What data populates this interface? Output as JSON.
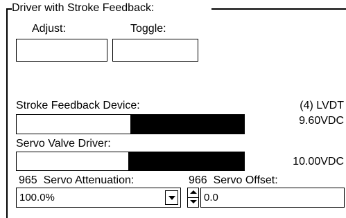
{
  "group": {
    "title": "Driver with Stroke Feedback:"
  },
  "adjust": {
    "label": "Adjust:",
    "value": ""
  },
  "toggle": {
    "label": "Toggle:",
    "value": ""
  },
  "stroke_feedback": {
    "label": "Stroke Feedback Device:",
    "device": "(4) LVDT",
    "reading": "9.60VDC",
    "white_fraction": 0.5,
    "black_fraction": 0.5
  },
  "servo_driver": {
    "label": "Servo Valve Driver:",
    "reading": "10.00VDC",
    "white_fraction": 0.49,
    "black_fraction": 0.51
  },
  "servo_attenuation": {
    "number": "965",
    "label": "Servo Attenuation:",
    "selected_value": "100.0%"
  },
  "servo_offset": {
    "number": "966",
    "label": "Servo Offset:",
    "value": "0.0"
  },
  "icons": {
    "dropdown": "chevron-down-icon",
    "spinner_up": "spinner-up-icon",
    "spinner_down": "spinner-down-icon"
  }
}
